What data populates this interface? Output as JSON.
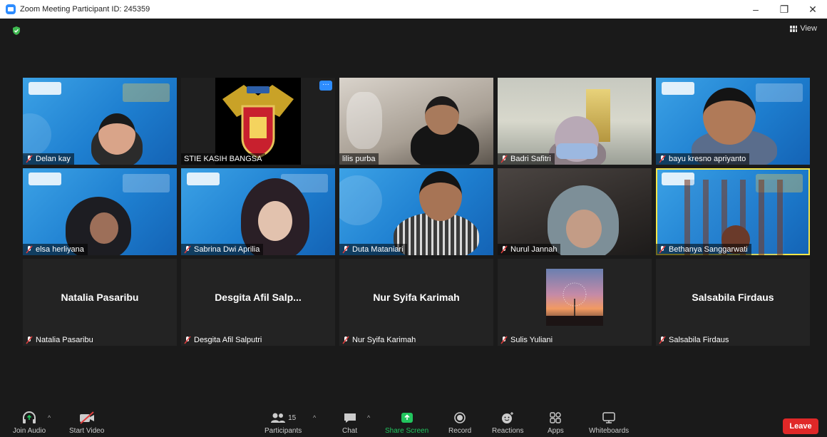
{
  "window": {
    "title": "Zoom Meeting Participant ID: 245359",
    "minimize": "–",
    "restore": "❐",
    "close": "✕"
  },
  "header": {
    "view_label": "View"
  },
  "tiles": [
    {
      "name": "Delan kay",
      "muted": true,
      "video": true
    },
    {
      "name": "STIE KASIH BANGSA",
      "muted": false,
      "video": true
    },
    {
      "name": "lilis purba",
      "muted": false,
      "video": true
    },
    {
      "name": "Badri Safitri",
      "muted": true,
      "video": true
    },
    {
      "name": "bayu kresno apriyanto",
      "muted": true,
      "video": true
    },
    {
      "name": "elsa herliyana",
      "muted": true,
      "video": true
    },
    {
      "name": "Sabrina Dwi Aprilia",
      "muted": true,
      "video": true
    },
    {
      "name": "Duta Mataniari",
      "muted": true,
      "video": true
    },
    {
      "name": "Nurul Jannah",
      "muted": true,
      "video": true
    },
    {
      "name": "Bethanya Sanggarwati",
      "muted": true,
      "video": true,
      "active_speaker": true
    },
    {
      "name": "Natalia Pasaribu",
      "display": "Natalia Pasaribu",
      "muted": true,
      "video": false
    },
    {
      "name": "Desgita Afil Salputri",
      "display": "Desgita Afil Salp...",
      "muted": true,
      "video": false
    },
    {
      "name": "Nur Syifa Karimah",
      "display": "Nur Syifa Karimah",
      "muted": true,
      "video": false
    },
    {
      "name": "Sulis Yuliani",
      "muted": true,
      "video": false,
      "photo": true
    },
    {
      "name": "Salsabila Firdaus",
      "display": "Salsabila Firdaus",
      "muted": true,
      "video": false
    }
  ],
  "tile_menu": "···",
  "toolbar": {
    "join_audio": "Join Audio",
    "start_video": "Start Video",
    "participants": "Participants",
    "participants_count": "15",
    "chat": "Chat",
    "share_screen": "Share Screen",
    "record": "Record",
    "reactions": "Reactions",
    "apps": "Apps",
    "whiteboards": "Whiteboards",
    "leave": "Leave",
    "caret": "^"
  },
  "colors": {
    "accent": "#2d8cff",
    "leave": "#e02828",
    "share": "#22c55e",
    "active_speaker": "#f5e64a",
    "mute": "#e03c3c"
  }
}
